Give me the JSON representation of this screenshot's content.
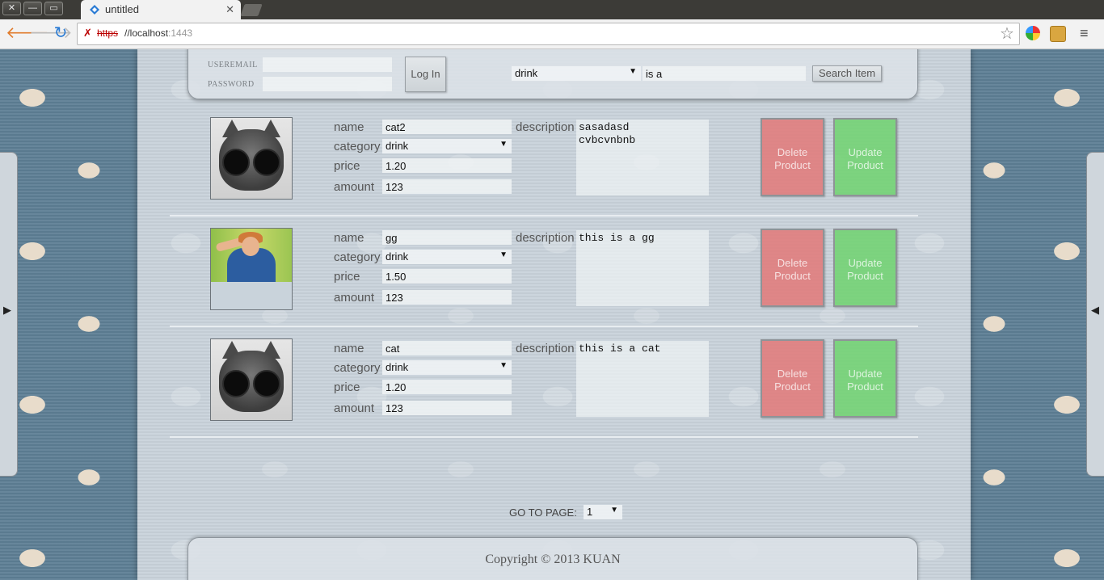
{
  "browser": {
    "tab_title": "untitled",
    "tab_close": "✕",
    "url_scheme": "https",
    "url_host": "//localhost",
    "url_port": ":1443",
    "window_controls": {
      "close": "✕",
      "minimize": "—",
      "maximize": "▭"
    },
    "nav": {
      "back": "🡐",
      "forward": "🡒",
      "reload": "↻",
      "star": "☆",
      "menu": "≡"
    },
    "icons": [
      "tab-favicon-icon",
      "back-icon",
      "forward-icon",
      "reload-icon",
      "insecure-lock-icon",
      "star-icon",
      "extension-icon",
      "extension-folder-icon",
      "menu-icon"
    ]
  },
  "header": {
    "useremail_label": "USEREMAIL",
    "password_label": "PASSWORD",
    "useremail_value": "",
    "password_value": "",
    "login_label": "Log In",
    "search_category": "drink",
    "search_text": "is a",
    "search_button": "Search Item"
  },
  "side": {
    "left_arrow": "▶",
    "right_arrow": "◀"
  },
  "labels": {
    "name": "name",
    "category": "category",
    "price": "price",
    "amount": "amount",
    "description": "description",
    "delete": "Delete Product",
    "update": "Update Product"
  },
  "products": [
    {
      "name": "cat2",
      "category": "drink",
      "price": "1.20",
      "amount": "123",
      "description": "sasadasd\ncvbcvnbnb",
      "image": "cat-with-sunglasses"
    },
    {
      "name": "gg",
      "category": "drink",
      "price": "1.50",
      "amount": "123",
      "description": "this is a gg",
      "image": "girl-in-denim-jacket"
    },
    {
      "name": "cat",
      "category": "drink",
      "price": "1.20",
      "amount": "123",
      "description": "this is a cat",
      "image": "cat-with-sunglasses"
    }
  ],
  "pagination": {
    "label": "GO TO PAGE:",
    "value": "1"
  },
  "footer": {
    "copyright": "Copyright © 2013 KUAN"
  },
  "colors": {
    "delete": "#e27878",
    "update": "#6ed26e",
    "panel": "#dce2e7"
  }
}
